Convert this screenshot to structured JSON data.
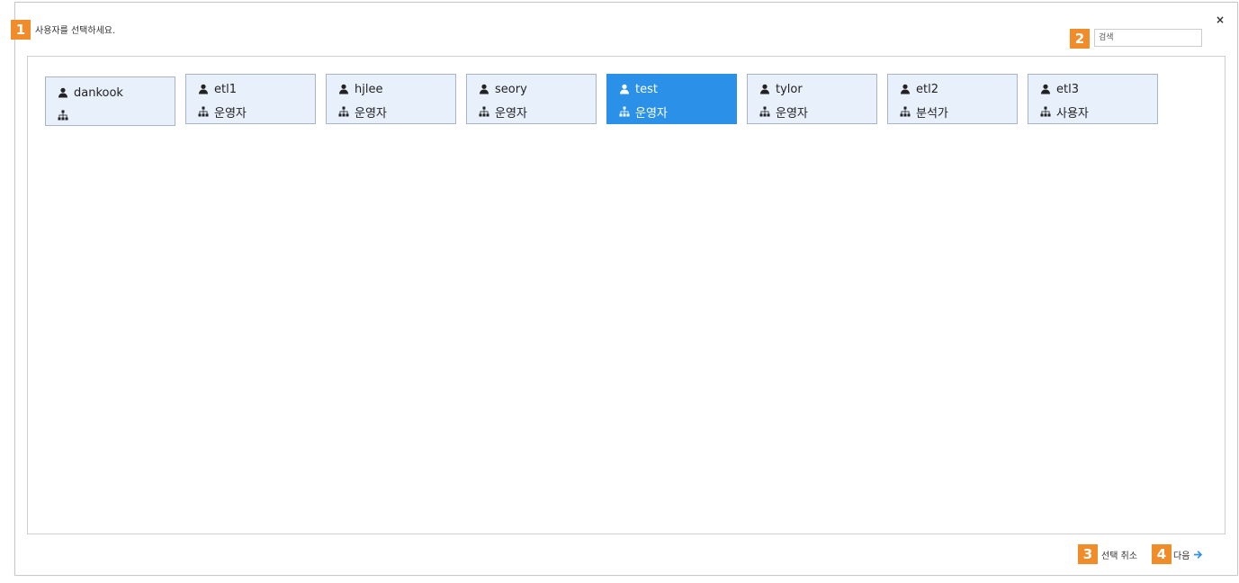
{
  "dialog": {
    "title": "사용자를 선택하세요.",
    "close_label": "×"
  },
  "badges": [
    "1",
    "2",
    "3",
    "4"
  ],
  "search": {
    "placeholder": "검색",
    "value": ""
  },
  "users": [
    {
      "name": "dankook",
      "role": "",
      "selected": false
    },
    {
      "name": "etl1",
      "role": "운영자",
      "selected": false
    },
    {
      "name": "hjlee",
      "role": "운영자",
      "selected": false
    },
    {
      "name": "seory",
      "role": "운영자",
      "selected": false
    },
    {
      "name": "test",
      "role": "운영자",
      "selected": true
    },
    {
      "name": "tylor",
      "role": "운영자",
      "selected": false
    },
    {
      "name": "etl2",
      "role": "분석가",
      "selected": false
    },
    {
      "name": "etl3",
      "role": "사용자",
      "selected": false
    }
  ],
  "footer": {
    "cancel_label": "선택 취소",
    "next_label": "다음"
  },
  "colors": {
    "accent": "#2b91e8",
    "badge": "#f08c2a",
    "card_bg": "#e8f0fc"
  },
  "icons": {
    "user": "user-icon",
    "role": "sitemap-icon",
    "next": "arrow-right-icon",
    "close": "close-icon"
  }
}
